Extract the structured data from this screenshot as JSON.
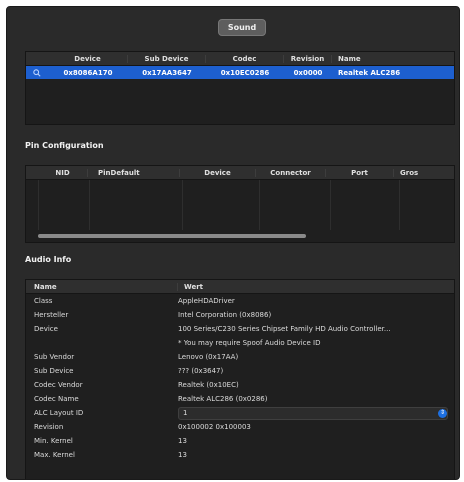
{
  "window": {
    "title": "Sound"
  },
  "device_table": {
    "columns": [
      "Device",
      "Sub Device",
      "Codec",
      "Revision",
      "Name"
    ],
    "rows": [
      {
        "device": "0x8086A170",
        "sub_device": "0x17AA3647",
        "codec": "0x10EC0286",
        "revision": "0x0000",
        "name": "Realtek ALC286",
        "icon": "magnifier-icon"
      }
    ]
  },
  "pin_config": {
    "title": "Pin Configuration",
    "columns": [
      "NID",
      "PinDefault",
      "Device",
      "Connector",
      "Port",
      "Gros"
    ]
  },
  "audio_info": {
    "title": "Audio Info",
    "columns": [
      "Name",
      "Wert"
    ],
    "rows": [
      {
        "key": "Class",
        "value": "AppleHDADriver"
      },
      {
        "key": "Hersteller",
        "value": "Intel Corporation (0x8086)"
      },
      {
        "key": "Device",
        "value": "100 Series/C230 Series Chipset Family HD Audio Controller..."
      },
      {
        "key": "",
        "value": "* You may require Spoof Audio Device ID"
      },
      {
        "key": "Sub Vendor",
        "value": "Lenovo (0x17AA)"
      },
      {
        "key": "Sub Device",
        "value": "??? (0x3647)"
      },
      {
        "key": "Codec Vendor",
        "value": "Realtek (0x10EC)"
      },
      {
        "key": "Codec Name",
        "value": "Realtek ALC286 (0x0286)"
      },
      {
        "key": "ALC Layout ID",
        "value": "1"
      },
      {
        "key": "Revision",
        "value": "0x100002 0x100003"
      },
      {
        "key": "Min. Kernel",
        "value": "13"
      },
      {
        "key": "Max. Kernel",
        "value": "13"
      }
    ]
  },
  "colors": {
    "selection": "#1d5fcf",
    "window": "#2a2a2a",
    "accent": "#1d6fe0"
  }
}
